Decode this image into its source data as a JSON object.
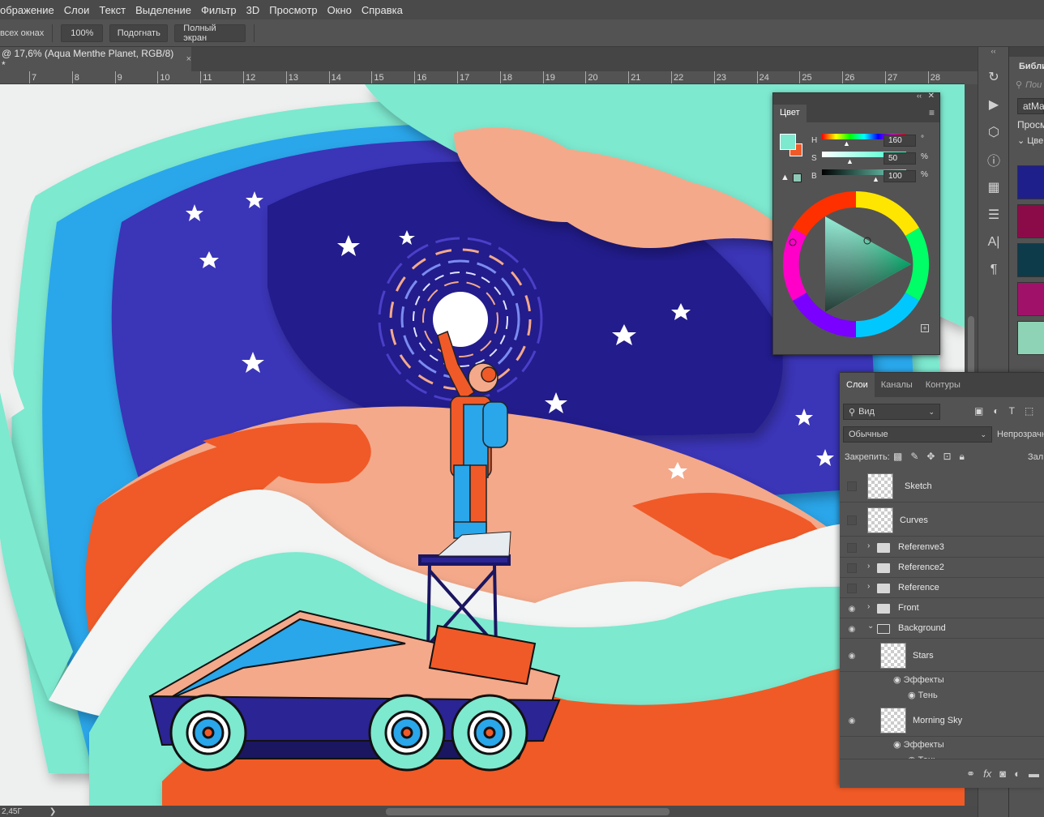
{
  "menu": [
    "ображение",
    "Слои",
    "Текст",
    "Выделение",
    "Фильтр",
    "3D",
    "Просмотр",
    "Окно",
    "Справка"
  ],
  "options": {
    "all_windows": "всех окнах",
    "zoom_btn": "100%",
    "fit_btn": "Подогнать",
    "fullscreen_btn": "Полный экран"
  },
  "document_tab": {
    "title": "@ 17,6% (Aqua Menthe Planet, RGB/8) *",
    "close": "×"
  },
  "ruler_ticks": [
    "7",
    "8",
    "9",
    "10",
    "11",
    "12",
    "13",
    "14",
    "15",
    "16",
    "17",
    "18",
    "19",
    "20",
    "21",
    "22",
    "23",
    "24",
    "25",
    "26",
    "27",
    "28"
  ],
  "status": {
    "size": "2,45Г",
    "arrow": "❯"
  },
  "color_panel": {
    "tab": "Цвет",
    "h_label": "H",
    "h_value": "160",
    "h_unit": "°",
    "s_label": "S",
    "s_value": "50",
    "s_unit": "%",
    "b_label": "B",
    "b_value": "100",
    "b_unit": "%",
    "foreground": "#7de9cf",
    "background": "#f05a28"
  },
  "library_panel": {
    "title": "Библи",
    "search_placeholder": "Пои",
    "library_name": "atMa",
    "view_label": "Просм",
    "section": "Цве",
    "swatches": [
      "#1e1f8a",
      "#8b0b49",
      "#0e3b4a",
      "#a0126a",
      "#8ed3b5"
    ]
  },
  "layers_panel": {
    "tabs": [
      "Слои",
      "Каналы",
      "Контуры"
    ],
    "filter_label": "Вид",
    "blend_mode": "Обычные",
    "opacity_label": "Непрозрачн",
    "lock_label": "Закрепить:",
    "fill_label": "Зал",
    "layers": [
      {
        "name": "Sketch",
        "visible": false,
        "kind": "layer"
      },
      {
        "name": "Curves",
        "visible": false,
        "kind": "layer"
      },
      {
        "name": "Referenve3",
        "visible": false,
        "kind": "group"
      },
      {
        "name": "Reference2",
        "visible": false,
        "kind": "group"
      },
      {
        "name": "Reference",
        "visible": false,
        "kind": "group"
      },
      {
        "name": "Front",
        "visible": true,
        "kind": "group"
      },
      {
        "name": "Background",
        "visible": true,
        "kind": "group-open"
      },
      {
        "name": "Stars",
        "visible": true,
        "kind": "layer"
      },
      {
        "name": "Morning Sky",
        "visible": true,
        "kind": "layer"
      }
    ],
    "effects_label": "Эффекты",
    "shadow_label": "Тень"
  }
}
